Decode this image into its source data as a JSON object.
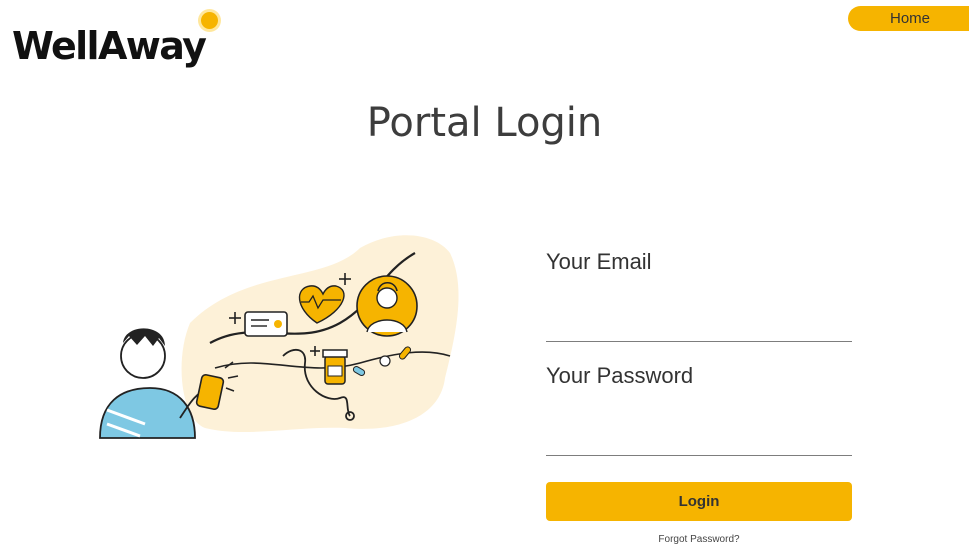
{
  "brand": {
    "name": "WellAway",
    "accent": "#f6b400"
  },
  "nav": {
    "home_label": "Home"
  },
  "page": {
    "title": "Portal Login"
  },
  "form": {
    "email_label": "Your Email",
    "email_value": "",
    "password_label": "Your Password",
    "password_value": "",
    "login_label": "Login",
    "forgot_label": "Forgot Password?"
  },
  "illustration": {
    "icons": [
      "person-with-phone",
      "id-card-icon",
      "heart-rate-icon",
      "doctor-avatar-icon",
      "stethoscope-icon",
      "medicine-bottle-icon",
      "pill-icon"
    ]
  }
}
